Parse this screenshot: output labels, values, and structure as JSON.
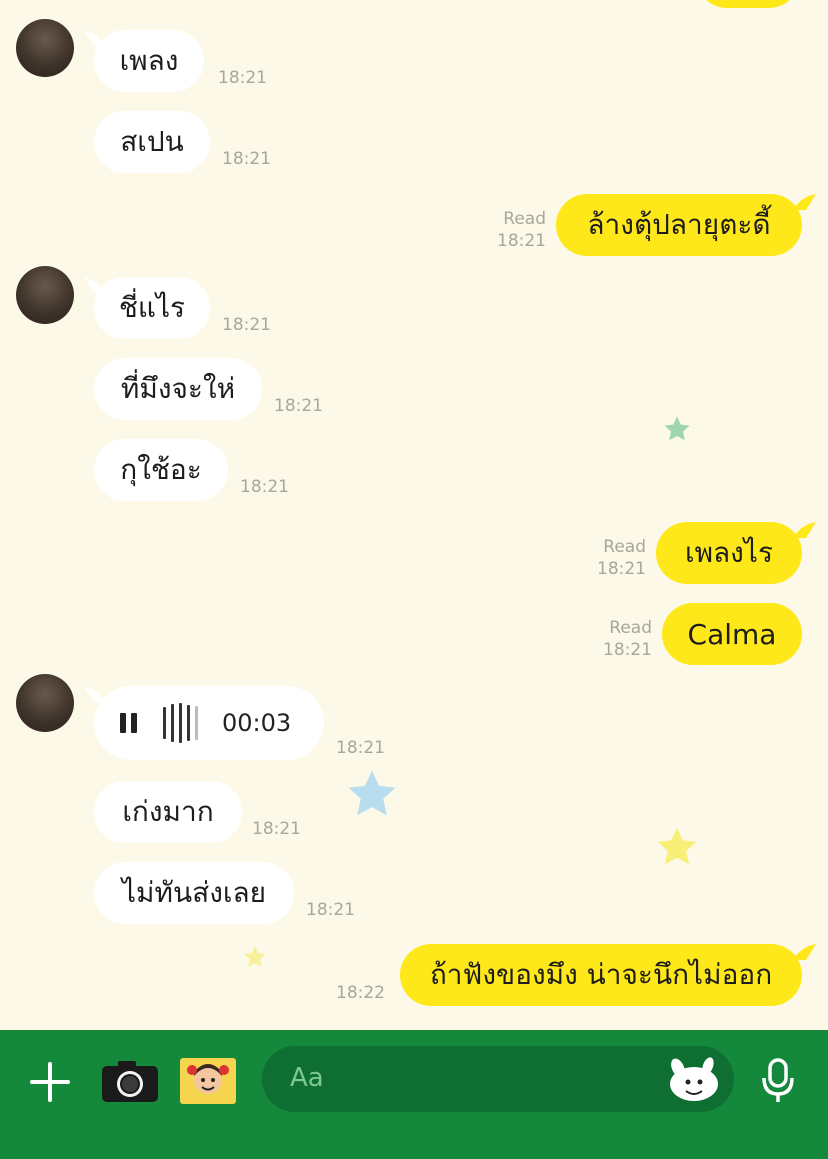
{
  "messages": [
    {
      "text": "เพลง",
      "time": "18:21"
    },
    {
      "text": "สเปน",
      "time": "18:21"
    },
    {
      "text": "ล้างตุ้ปลายุตะดี้",
      "status": "Read",
      "time": "18:21"
    },
    {
      "text": "ชี่แไร",
      "time": "18:21"
    },
    {
      "text": "ที่มึงจะให่",
      "time": "18:21"
    },
    {
      "text": "กุใช้อะ",
      "time": "18:21"
    },
    {
      "text": "เพลงไร",
      "status": "Read",
      "time": "18:21"
    },
    {
      "text": "Calma",
      "status": "Read",
      "time": "18:21"
    },
    {
      "duration": "00:03",
      "time": "18:21"
    },
    {
      "text": "เก่งมาก",
      "time": "18:21"
    },
    {
      "text": "ไม่ทันส่งเลย",
      "time": "18:21"
    },
    {
      "text": "ถ้าฟังของมึง น่าจะนึกไม่ออก",
      "time": "18:22"
    }
  ],
  "input": {
    "placeholder": "Aa"
  },
  "icons": {
    "add": "plus-icon",
    "camera": "camera-icon",
    "gallery": "image-gallery-icon",
    "sticker": "sticker-icon",
    "voice": "microphone-icon",
    "voice_control": "pause-icon"
  },
  "colors": {
    "background": "#fdf9e8",
    "outgoing_bubble": "#ffe81a",
    "incoming_bubble": "#ffffff",
    "bottom_bar": "#14893c",
    "input_field": "#0f6e31"
  }
}
